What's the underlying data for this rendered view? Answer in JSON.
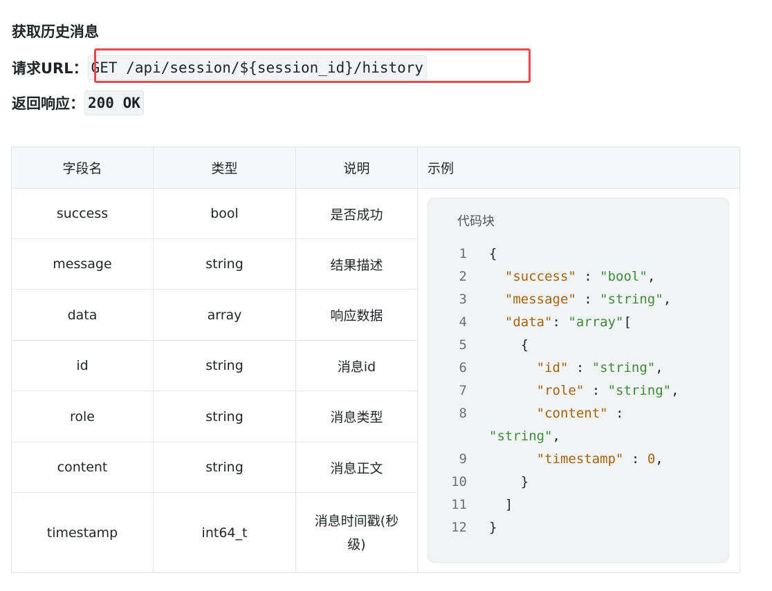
{
  "section": {
    "title": "获取历史消息"
  },
  "request": {
    "label": "请求URL：",
    "value": "GET /api/session/${session_id}/history"
  },
  "response": {
    "label": "返回响应：",
    "value": "200 OK"
  },
  "table": {
    "headers": [
      "字段名",
      "类型",
      "说明",
      "示例"
    ],
    "rows": [
      {
        "field": "success",
        "type": "bool",
        "desc": "是否成功"
      },
      {
        "field": "message",
        "type": "string",
        "desc": "结果描述"
      },
      {
        "field": "data",
        "type": "array",
        "desc": "响应数据"
      },
      {
        "field": "id",
        "type": "string",
        "desc": "消息id"
      },
      {
        "field": "role",
        "type": "string",
        "desc": "消息类型"
      },
      {
        "field": "content",
        "type": "string",
        "desc": "消息正文"
      },
      {
        "field": "timestamp",
        "type": "int64_t",
        "desc_line1": "消息时间戳(秒",
        "desc_line2": "级)"
      }
    ]
  },
  "codeblock": {
    "title": "代码块",
    "lines": [
      {
        "n": "1",
        "tokens": [
          [
            "p",
            "{"
          ]
        ]
      },
      {
        "n": "2",
        "tokens": [
          [
            "p",
            "  "
          ],
          [
            "k",
            "\"success\""
          ],
          [
            "p",
            " : "
          ],
          [
            "s",
            "\"bool\""
          ],
          [
            "p",
            ","
          ]
        ]
      },
      {
        "n": "3",
        "tokens": [
          [
            "p",
            "  "
          ],
          [
            "k",
            "\"message\""
          ],
          [
            "p",
            " : "
          ],
          [
            "s",
            "\"string\""
          ],
          [
            "p",
            ","
          ]
        ]
      },
      {
        "n": "4",
        "tokens": [
          [
            "p",
            "  "
          ],
          [
            "k",
            "\"data\""
          ],
          [
            "p",
            ": "
          ],
          [
            "s",
            "\"array\""
          ],
          [
            "p",
            "["
          ]
        ]
      },
      {
        "n": "5",
        "tokens": [
          [
            "p",
            "    {"
          ]
        ]
      },
      {
        "n": "6",
        "tokens": [
          [
            "p",
            "      "
          ],
          [
            "k",
            "\"id\""
          ],
          [
            "p",
            " : "
          ],
          [
            "s",
            "\"string\""
          ],
          [
            "p",
            ","
          ]
        ]
      },
      {
        "n": "7",
        "tokens": [
          [
            "p",
            "      "
          ],
          [
            "k",
            "\"role\""
          ],
          [
            "p",
            " : "
          ],
          [
            "s",
            "\"string\""
          ],
          [
            "p",
            ","
          ]
        ]
      },
      {
        "n": "8",
        "tokens": [
          [
            "p",
            "      "
          ],
          [
            "k",
            "\"content\""
          ],
          [
            "p",
            " :"
          ]
        ]
      },
      {
        "n": "",
        "tokens": [
          [
            "s",
            "\"string\""
          ],
          [
            "p",
            ","
          ]
        ],
        "wrap": true
      },
      {
        "n": "9",
        "tokens": [
          [
            "p",
            "      "
          ],
          [
            "k",
            "\"timestamp\""
          ],
          [
            "p",
            " : "
          ],
          [
            "n",
            "0"
          ],
          [
            "p",
            ","
          ]
        ]
      },
      {
        "n": "10",
        "tokens": [
          [
            "p",
            "    }"
          ]
        ]
      },
      {
        "n": "11",
        "tokens": [
          [
            "p",
            "  ]"
          ]
        ]
      },
      {
        "n": "12",
        "tokens": [
          [
            "p",
            "}"
          ]
        ]
      }
    ]
  }
}
